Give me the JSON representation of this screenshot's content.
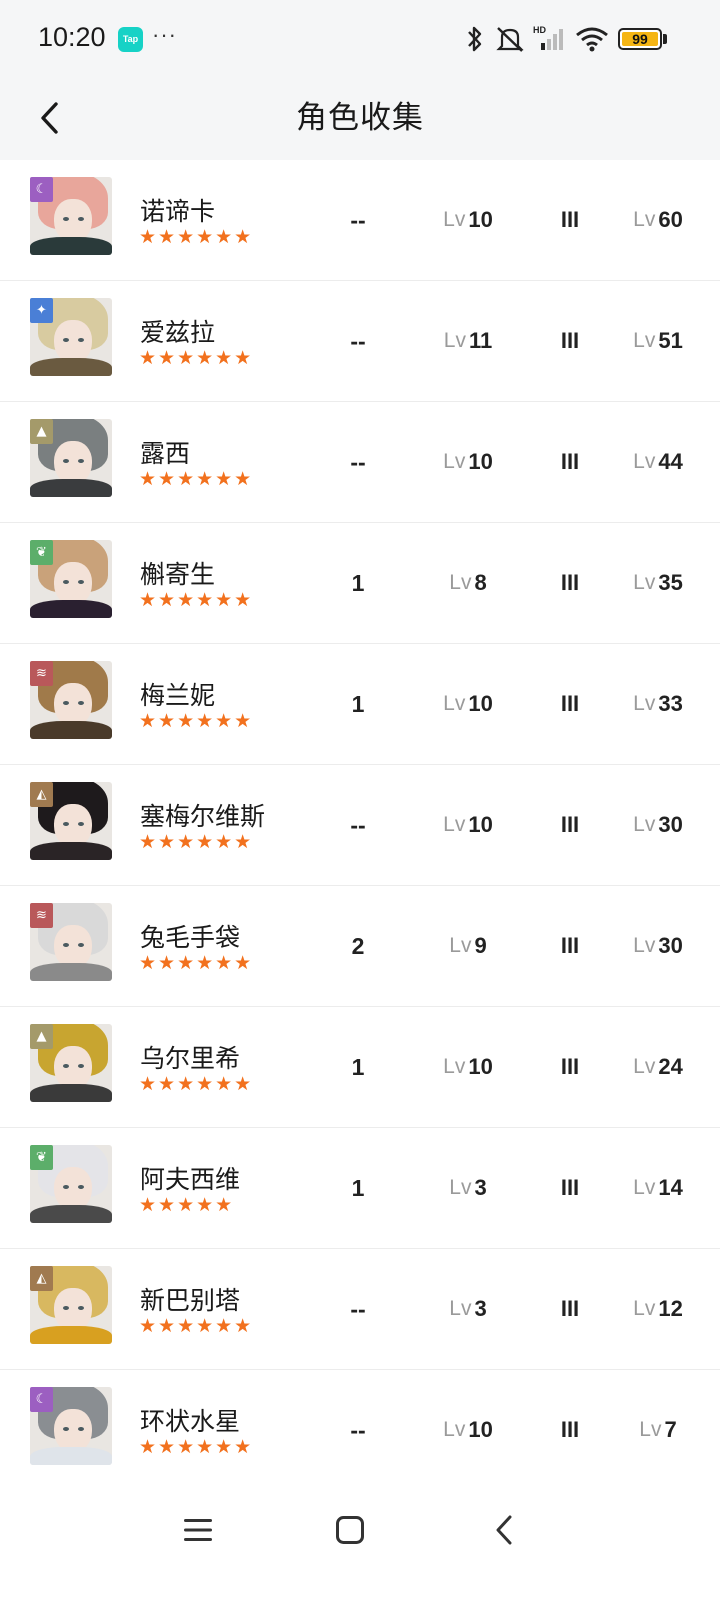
{
  "status_bar": {
    "time": "10:20",
    "app_badge": "Tap",
    "more": "···",
    "battery": "99",
    "battery_level": 0.99,
    "icons": [
      "bluetooth-icon",
      "mute-icon",
      "signal-icon",
      "wifi-icon",
      "battery-icon"
    ]
  },
  "header": {
    "title": "角色收集",
    "back_icon": "chevron-left-icon"
  },
  "colors": {
    "star": "#f2711e",
    "badge_spirit": "#9c5fc1",
    "badge_star": "#4a7fd6",
    "badge_mineral": "#a49a6a",
    "badge_plant": "#5cae6a",
    "badge_beast": "#b9585a",
    "badge_intellect": "#a07a50"
  },
  "characters": [
    {
      "name": "诺谛卡",
      "stars": "★★★★★★",
      "afflatus": "spirit",
      "badge_glyph": "☾",
      "insight": "--",
      "lv_label": "Lv",
      "skill_level": "10",
      "phase": "III",
      "level": "60",
      "hair": "#e8a69b",
      "outfit": "#2a3a3a"
    },
    {
      "name": "爱兹拉",
      "stars": "★★★★★★",
      "afflatus": "star",
      "badge_glyph": "✦",
      "insight": "--",
      "lv_label": "Lv",
      "skill_level": "11",
      "phase": "III",
      "level": "51",
      "hair": "#d8cba0",
      "outfit": "#6a5a40"
    },
    {
      "name": "露西",
      "stars": "★★★★★★",
      "afflatus": "mineral",
      "badge_glyph": "▲",
      "insight": "--",
      "lv_label": "Lv",
      "skill_level": "10",
      "phase": "III",
      "level": "44",
      "hair": "#7a7f80",
      "outfit": "#3a3c3e"
    },
    {
      "name": "槲寄生",
      "stars": "★★★★★★",
      "afflatus": "plant",
      "badge_glyph": "❦",
      "insight": "1",
      "lv_label": "Lv",
      "skill_level": "8",
      "phase": "III",
      "level": "35",
      "hair": "#c9a27a",
      "outfit": "#2a2030"
    },
    {
      "name": "梅兰妮",
      "stars": "★★★★★★",
      "afflatus": "beast",
      "badge_glyph": "≋",
      "insight": "1",
      "lv_label": "Lv",
      "skill_level": "10",
      "phase": "III",
      "level": "33",
      "hair": "#a07a4a",
      "outfit": "#4a3a2a"
    },
    {
      "name": "塞梅尔维斯",
      "stars": "★★★★★★",
      "afflatus": "intellect",
      "badge_glyph": "◭",
      "insight": "--",
      "lv_label": "Lv",
      "skill_level": "10",
      "phase": "III",
      "level": "30",
      "hair": "#1e1a1c",
      "outfit": "#2a2426"
    },
    {
      "name": "兔毛手袋",
      "stars": "★★★★★★",
      "afflatus": "beast",
      "badge_glyph": "≋",
      "insight": "2",
      "lv_label": "Lv",
      "skill_level": "9",
      "phase": "III",
      "level": "30",
      "hair": "#d9d9d9",
      "outfit": "#8a8a8a"
    },
    {
      "name": "乌尔里希",
      "stars": "★★★★★★",
      "afflatus": "mineral",
      "badge_glyph": "▲",
      "insight": "1",
      "lv_label": "Lv",
      "skill_level": "10",
      "phase": "III",
      "level": "24",
      "hair": "#c8a530",
      "outfit": "#3a3a3a"
    },
    {
      "name": "阿夫西维",
      "stars": "★★★★★",
      "afflatus": "plant",
      "badge_glyph": "❦",
      "insight": "1",
      "lv_label": "Lv",
      "skill_level": "3",
      "phase": "III",
      "level": "14",
      "hair": "#e4e4e8",
      "outfit": "#4a4a4a"
    },
    {
      "name": "新巴别塔",
      "stars": "★★★★★★",
      "afflatus": "intellect",
      "badge_glyph": "◭",
      "insight": "--",
      "lv_label": "Lv",
      "skill_level": "3",
      "phase": "III",
      "level": "12",
      "hair": "#d8b860",
      "outfit": "#d8a020"
    },
    {
      "name": "环状水星",
      "stars": "★★★★★★",
      "afflatus": "spirit",
      "badge_glyph": "☾",
      "insight": "--",
      "lv_label": "Lv",
      "skill_level": "10",
      "phase": "III",
      "level": "7",
      "hair": "#8a8e92",
      "outfit": "#dfe4ea"
    }
  ],
  "nav_bar": {
    "icons": [
      "menu-icon",
      "home-square-icon",
      "back-triangle-icon"
    ]
  }
}
